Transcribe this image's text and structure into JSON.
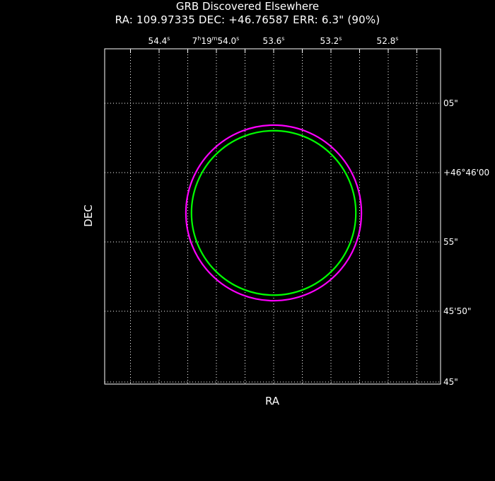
{
  "title": "GRB Discovered Elsewhere",
  "subtitle": "RA: 109.97335  DEC: +46.76587  ERR: 6.3\" (90%)",
  "chart_data": {
    "type": "scatter",
    "title": "GRB Discovered Elsewhere",
    "subtitle": "RA: 109.97335  DEC: +46.76587  ERR: 6.3\" (90%)",
    "xlabel": "RA",
    "ylabel": "DEC",
    "grid": true,
    "ra_ticks": [
      {
        "label": "54.4",
        "unit": "s"
      },
      {
        "label": "7h19m54.0",
        "unit": "s"
      },
      {
        "label": "53.6",
        "unit": "s"
      },
      {
        "label": "53.2",
        "unit": "s"
      },
      {
        "label": "52.8",
        "unit": "s"
      }
    ],
    "dec_ticks": [
      "05\"",
      "+46°46'00",
      "55\"",
      "45'50\"",
      "45\""
    ],
    "series": [
      {
        "name": "error circle (magenta)",
        "center_ra": 109.97335,
        "center_dec": 46.76587,
        "radius_arcsec": 6.3,
        "color": "#ff00ff"
      },
      {
        "name": "error circle (green)",
        "center_ra": 109.97335,
        "center_dec": 46.76587,
        "radius_arcsec": 5.9,
        "color": "#00ff00"
      }
    ]
  }
}
